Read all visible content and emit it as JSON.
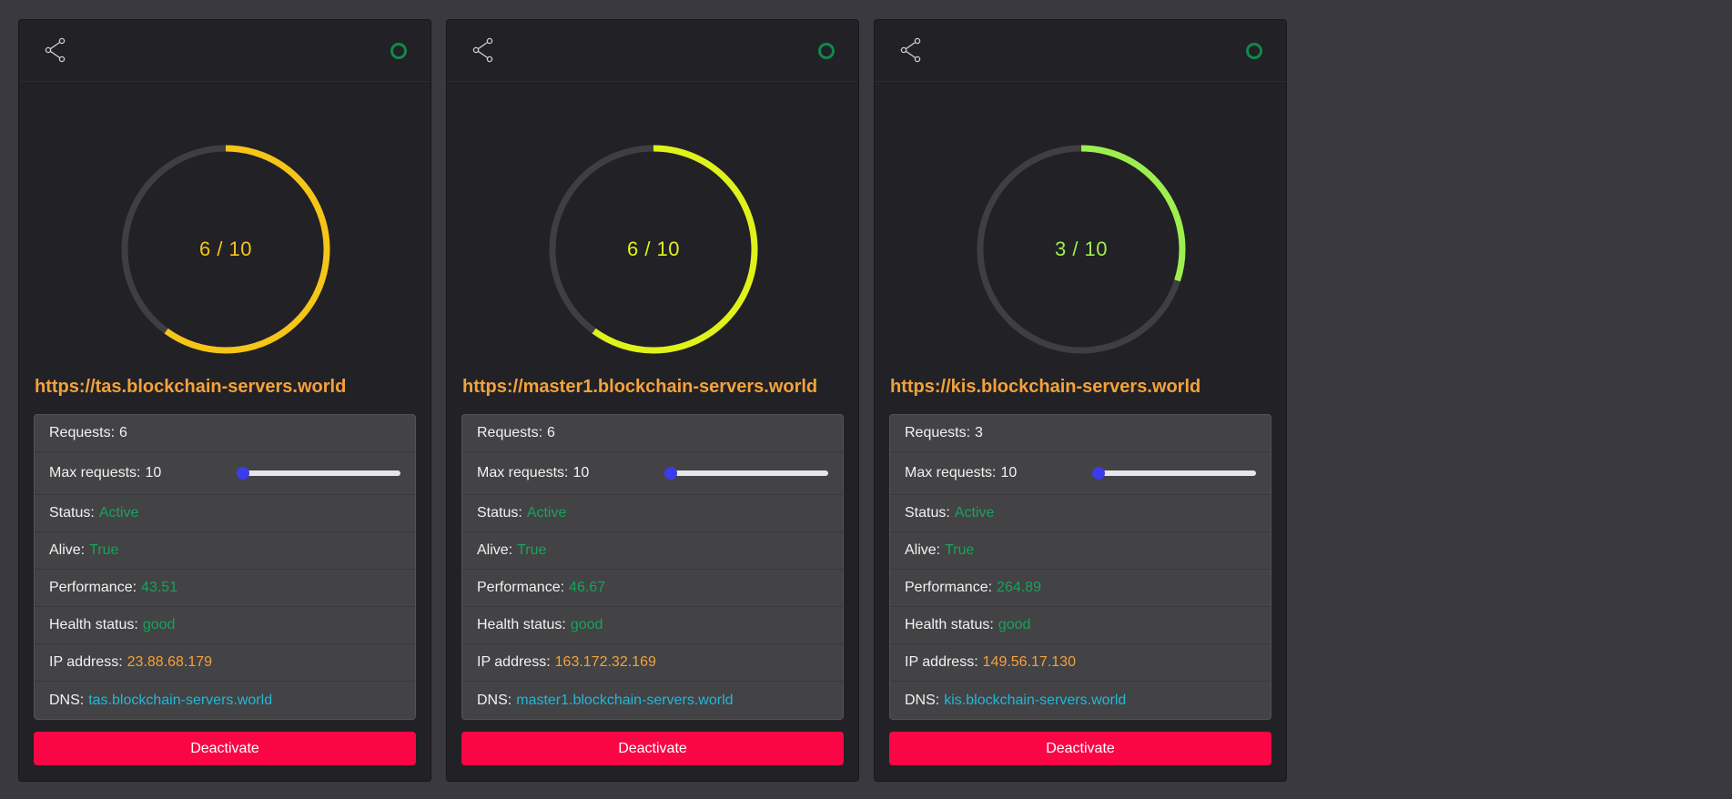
{
  "servers": [
    {
      "url": "https://tas.blockchain-servers.world",
      "gauge": {
        "current": 6,
        "max": 10,
        "text": "6 / 10",
        "color": "#f5c518"
      },
      "requests_label": "Requests:",
      "requests_value": "6",
      "max_requests_label": "Max requests:",
      "max_requests_value": "10",
      "slider_level": 0,
      "status_label": "Status:",
      "status_value": "Active",
      "alive_label": "Alive:",
      "alive_value": "True",
      "performance_label": "Performance:",
      "performance_value": "43.51",
      "health_label": "Health status:",
      "health_value": "good",
      "ip_label": "IP address:",
      "ip_value": "23.88.68.179",
      "dns_label": "DNS:",
      "dns_value": "tas.blockchain-servers.world",
      "button_label": "Deactivate"
    },
    {
      "url": "https://master1.blockchain-servers.world",
      "gauge": {
        "current": 6,
        "max": 10,
        "text": "6 / 10",
        "color": "#dff21a"
      },
      "requests_label": "Requests:",
      "requests_value": "6",
      "max_requests_label": "Max requests:",
      "max_requests_value": "10",
      "slider_level": 0,
      "status_label": "Status:",
      "status_value": "Active",
      "alive_label": "Alive:",
      "alive_value": "True",
      "performance_label": "Performance:",
      "performance_value": "46.67",
      "health_label": "Health status:",
      "health_value": "good",
      "ip_label": "IP address:",
      "ip_value": "163.172.32.169",
      "dns_label": "DNS:",
      "dns_value": "master1.blockchain-servers.world",
      "button_label": "Deactivate"
    },
    {
      "url": "https://kis.blockchain-servers.world",
      "gauge": {
        "current": 3,
        "max": 10,
        "text": "3 / 10",
        "color": "#9def4f"
      },
      "requests_label": "Requests:",
      "requests_value": "3",
      "max_requests_label": "Max requests:",
      "max_requests_value": "10",
      "slider_level": 0,
      "status_label": "Status:",
      "status_value": "Active",
      "alive_label": "Alive:",
      "alive_value": "True",
      "performance_label": "Performance:",
      "performance_value": "264.89",
      "health_label": "Health status:",
      "health_value": "good",
      "ip_label": "IP address:",
      "ip_value": "149.56.17.130",
      "dns_label": "DNS:",
      "dns_value": "kis.blockchain-servers.world",
      "button_label": "Deactivate"
    }
  ],
  "colors": {
    "background": "#3a393f",
    "card": "#222125",
    "gauge_track": "#3f3e42",
    "status_online": "#0f8a4c",
    "value_green": "#17a35c",
    "value_orange": "#f2a23c",
    "value_cyan": "#22b7d8",
    "slider_thumb": "#3b3bea",
    "deactivate": "#fb0645"
  },
  "icons": {
    "share": "share-icon",
    "status": "status-indicator-icon"
  }
}
